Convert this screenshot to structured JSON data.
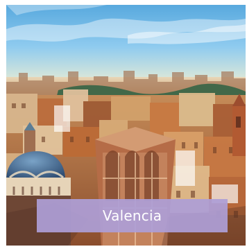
{
  "card": {
    "caption": "Valencia",
    "caption_color": "#AD9ED6",
    "image_icon": "valencia-cityscape-photo"
  }
}
